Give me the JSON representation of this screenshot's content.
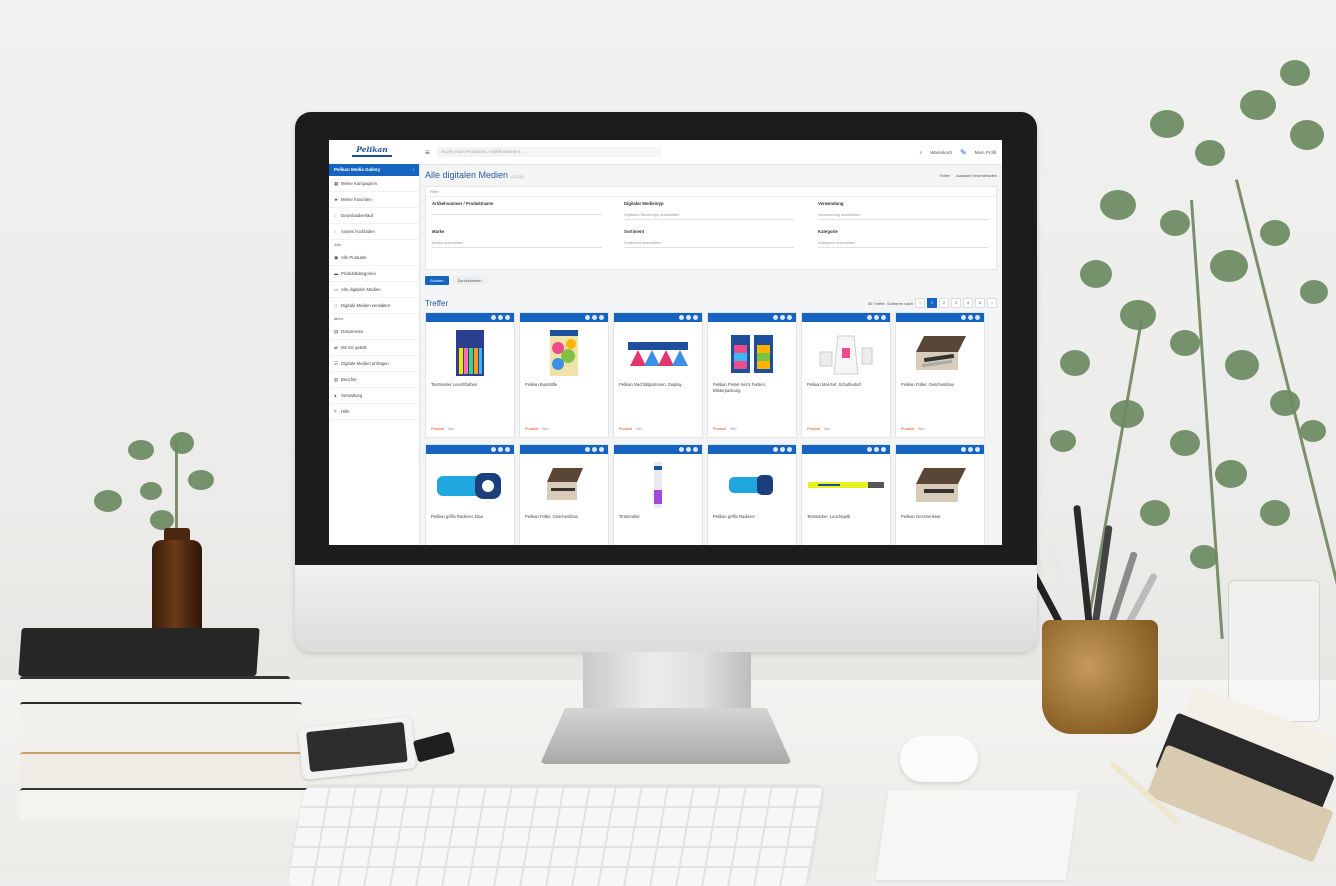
{
  "app": {
    "brand": "Pelikan",
    "search_placeholder": "Suche nach Produkten, Artikelnummern...",
    "top_links": [
      "Warenkorb",
      "Bearbeiten",
      "Mein Profil"
    ]
  },
  "sidebar": {
    "header": "Pelikan Media Gallery",
    "items_top": [
      {
        "icon": "grid-icon",
        "label": "Meine Kampagnen"
      },
      {
        "icon": "star-icon",
        "label": "Meine Favoriten"
      },
      {
        "icon": "download-icon",
        "label": "Downloadverlauf"
      },
      {
        "icon": "upload-icon",
        "label": "Assets hochladen"
      }
    ],
    "section1": "Alle",
    "items_mid": [
      {
        "icon": "image-icon",
        "label": "Alle Produkte"
      },
      {
        "icon": "folder-icon",
        "label": "Produktkategorien"
      },
      {
        "icon": "film-icon",
        "label": "Alle digitalen Medien"
      },
      {
        "icon": "box-icon",
        "label": "Digitale Medien verwalten"
      }
    ],
    "section2": "Mehr",
    "items_bottom": [
      {
        "icon": "doc-icon",
        "label": "Dokumente"
      },
      {
        "icon": "share-icon",
        "label": "Mit mir geteilt"
      },
      {
        "icon": "list-icon",
        "label": "Digitale Medien anfragen"
      },
      {
        "icon": "chart-icon",
        "label": "Berichte"
      },
      {
        "icon": "user-icon",
        "label": "Verwaltung"
      },
      {
        "icon": "help-icon",
        "label": "Hilfe"
      }
    ]
  },
  "main": {
    "title": "Alle digitalen Medien",
    "title_count": "(1.270)",
    "actions": [
      "Teilen",
      "Auswahl herunterladen"
    ],
    "filter_header": "Filter",
    "filters": [
      {
        "label": "Artikelnummer / Produktname",
        "value": ""
      },
      {
        "label": "Digitaler Medientyp",
        "value": "Digitalen Medientyp auswählen"
      },
      {
        "label": "Verwendung",
        "value": "Verwendung auswählen"
      },
      {
        "label": "Marke",
        "value": "Marke auswählen"
      },
      {
        "label": "Sortiment",
        "value": "Sortiment auswählen"
      },
      {
        "label": "Kategorie",
        "value": "Kategorie auswählen"
      }
    ],
    "filter_button": "Suchen",
    "reset_button": "Zurücksetzen",
    "results_title": "Treffer",
    "pager": {
      "per_page": "50 Treffer",
      "sort": "Sortieren nach",
      "pages": [
        "1",
        "2",
        "3",
        "4",
        "5"
      ],
      "active_page": "1"
    },
    "cards": [
      {
        "title": "Textmarker Leuchtfarben",
        "tag1": "Produkt",
        "tag2": "Bild"
      },
      {
        "title": "Pelikan Buntstifte",
        "tag1": "Produkt",
        "tag2": "Bild"
      },
      {
        "title": "Pelikan Nachfüllpatronen, Display",
        "tag1": "Produkt",
        "tag2": "Bild"
      },
      {
        "title": "Pelikan Pinsel-Set 5 Farben, Blisterpackung",
        "tag1": "Produkt",
        "tag2": "Bild"
      },
      {
        "title": "Pelikan Mal-Set, Schulbedarf",
        "tag1": "Produkt",
        "tag2": "Bild"
      },
      {
        "title": "Pelikan Füller, Geschenkbox",
        "tag1": "Produkt",
        "tag2": "Bild"
      },
      {
        "title": "Pelikan griffix Radierer, blau",
        "tag1": "",
        "tag2": ""
      },
      {
        "title": "Pelikan Füller, Geschenkbox",
        "tag1": "",
        "tag2": ""
      },
      {
        "title": "Tintenroller",
        "tag1": "",
        "tag2": ""
      },
      {
        "title": "Pelikan griffix Radierer",
        "tag1": "",
        "tag2": ""
      },
      {
        "title": "Textmarker, Leuchtgelb",
        "tag1": "",
        "tag2": ""
      },
      {
        "title": "Pelikan Geschenkset",
        "tag1": "",
        "tag2": ""
      }
    ]
  },
  "colors": {
    "accent": "#1565c0",
    "sidebar_bg": "#ffffff",
    "screen_bg": "#f3f4f6"
  }
}
